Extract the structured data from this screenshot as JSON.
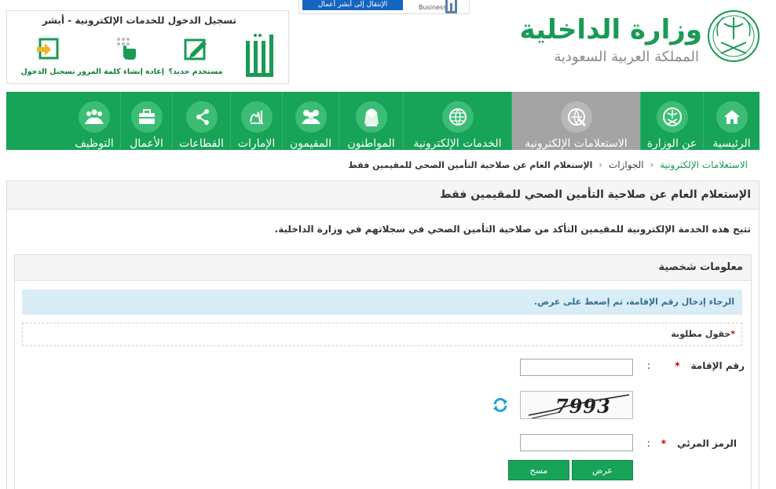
{
  "header": {
    "ministry_name": "وزارة الداخلية",
    "kingdom_name": "المملكة العربية السعودية",
    "business_button": "الإنتقال إلى أبشر أعمال",
    "business_logo_text": "Business"
  },
  "absher": {
    "title": "تسجيل الدخول للخدمات الإلكترونية - أبشر",
    "links": [
      {
        "label": "مستخدم جديد؟",
        "icon": "new-user-icon"
      },
      {
        "label": "إعادة إنشاء كلمة المرور",
        "icon": "reset-password-icon"
      },
      {
        "label": "تسجيل الدخول",
        "icon": "login-icon"
      }
    ]
  },
  "nav": {
    "items": [
      {
        "label": "الرئيسية",
        "icon": "home-icon"
      },
      {
        "label": "عن الوزارة",
        "icon": "emblem-icon"
      },
      {
        "label": "الاستعلامات الإلكترونية",
        "icon": "inquiry-icon"
      },
      {
        "label": "الخدمات الإلكترونية",
        "icon": "globe-icon"
      },
      {
        "label": "المواطنون",
        "icon": "citizen-icon"
      },
      {
        "label": "المقيمون",
        "icon": "residents-icon"
      },
      {
        "label": "الإمارات",
        "icon": "emirates-icon"
      },
      {
        "label": "القطاعات",
        "icon": "sectors-icon"
      },
      {
        "label": "الأعمال",
        "icon": "briefcase-icon"
      },
      {
        "label": "التوظيف",
        "icon": "employment-icon"
      }
    ],
    "active_index": 2
  },
  "breadcrumb": {
    "root": "الاستعلامات الإلكترونية",
    "middle": "الجوازات",
    "current": "الإستعلام العام عن صلاحية التأمين الصحي للمقيمين فقط",
    "separator": "‹"
  },
  "main": {
    "title": "الإستعلام العام عن صلاحية التأمين الصحي للمقيمين فقط",
    "description": "تتيح هذه الخدمة الإلكترونية للمقيمين التأكد من صلاحية التأمين الصحي في سجلاتهم في وزارة الداخلية."
  },
  "form": {
    "section_title": "معلومات شخصية",
    "info_message": "الرجاء إدخال رقم الإقامة، ثم إضغط على عرض.",
    "required_note": "حقول مطلوبة",
    "required_mark": "*",
    "colon": ":",
    "iqama_label": "رقم الإقامة",
    "iqama_value": "",
    "captcha_text": "7993",
    "captcha_label": "الرمز المرئي",
    "captcha_value": "",
    "submit_label": "عرض",
    "clear_label": "مسح"
  },
  "colors": {
    "brand_green": "#17a358",
    "active_gray": "#a3a3a3",
    "info_bg": "#d9edf7"
  }
}
